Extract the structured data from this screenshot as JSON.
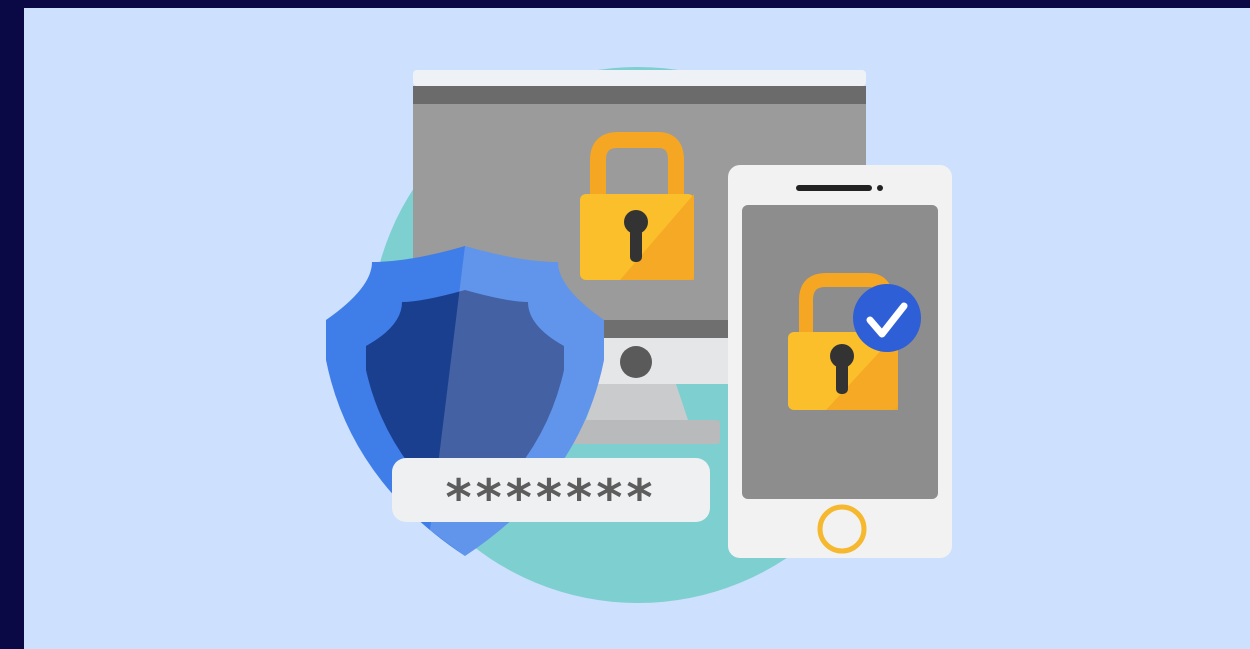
{
  "illustration": {
    "password_field": {
      "masked_text": "*******"
    },
    "colors": {
      "outer_border": "#0a0845",
      "background": "#cde0fd",
      "backdrop_circle": "#7ecfd0",
      "monitor_screen": "#9b9b9b",
      "lock_body": "#fbbf2c",
      "lock_shadow": "#f5a623",
      "shield_outer": "#3f7ee8",
      "shield_inner": "#1a3f8f",
      "check_badge": "#2f5fd6",
      "phone_body": "#f2f2f2",
      "phone_home_button": "#f5b82e"
    },
    "icons": [
      "monitor-icon",
      "padlock-icon",
      "shield-icon",
      "smartphone-icon",
      "checkmark-icon",
      "password-field"
    ]
  }
}
